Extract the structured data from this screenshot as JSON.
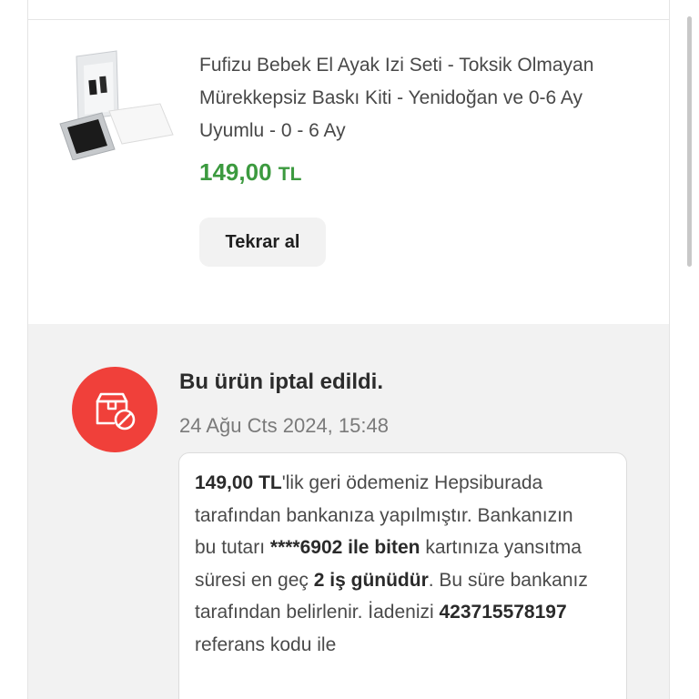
{
  "product": {
    "title": "Fufizu Bebek El Ayak Izi Seti - Toksik Olmayan Mürekkepsiz Baskı Kiti - Yenidoğan ve 0-6 Ay Uyumlu - 0 - 6 Ay",
    "price": "149,00",
    "currency": "TL",
    "reorder_label": "Tekrar al",
    "image_icon": "product-thumbnail"
  },
  "cancellation": {
    "icon": "cancelled-package-icon",
    "title": "Bu ürün iptal edildi.",
    "date": "24 Ağu Cts 2024, 15:48",
    "refund": {
      "amount": "149,00 TL",
      "t1": "'lik geri ödemeniz Hepsiburada tarafından bankanıza yapılmıştır. Bankanızın bu tutarı ",
      "card": "****6902 ile biten",
      "t2": " kartınıza yansıtma süresi en geç ",
      "days": "2 iş günüdür",
      "t3": ". Bu süre bankanız tarafından belirlenir. İadenizi ",
      "reference": "423715578197",
      "t4": " referans kodu ile"
    }
  },
  "colors": {
    "price_green": "#3c9a3f",
    "cancel_red": "#f0403a",
    "section_gray": "#f2f2f2"
  }
}
